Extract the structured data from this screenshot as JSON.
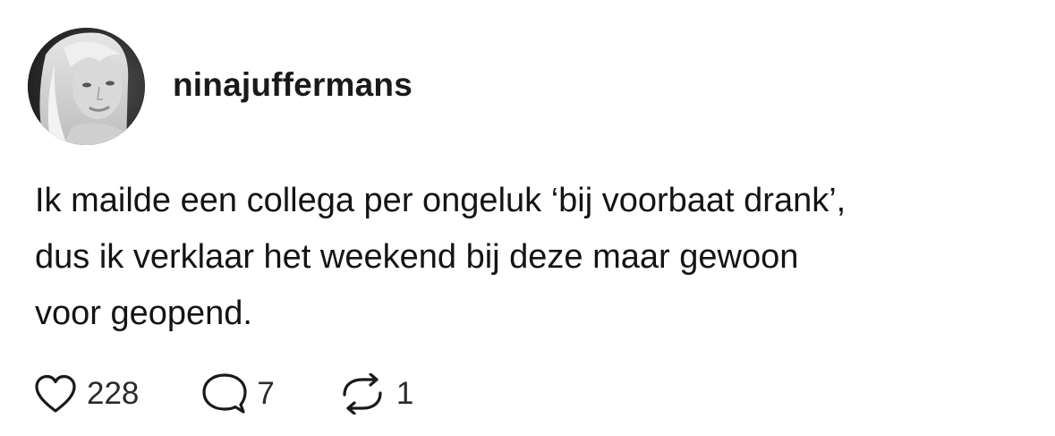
{
  "post": {
    "username": "ninajuffermans",
    "text_lines": [
      "Ik mailde een collega per ongeluk ‘bij voorbaat drank’,",
      "dus ik verklaar het weekend bij deze maar gewoon",
      "voor geopend."
    ],
    "avatar": "profile-photo (black and white portrait)"
  },
  "actions": {
    "likes": "228",
    "replies": "7",
    "reposts": "1"
  },
  "icons": {
    "like": "heart-icon",
    "reply": "speech-bubble-icon",
    "repost": "repost-arrows-icon"
  },
  "colors": {
    "text": "#141414",
    "icon": "#1a1a1a"
  }
}
